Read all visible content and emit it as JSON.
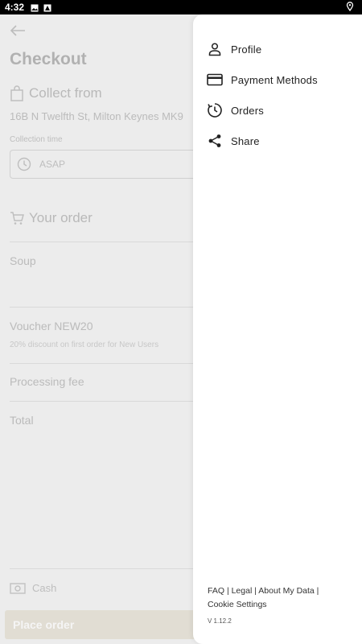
{
  "status_bar": {
    "time": "4:32"
  },
  "checkout": {
    "title": "Checkout",
    "collect_from": "Collect from",
    "address": "16B N  Twelfth St, Milton Keynes MK9",
    "collection_time_label": "Collection time",
    "collection_time_value": "ASAP",
    "your_order": "Your order",
    "items": [
      "Soup"
    ],
    "voucher": "Voucher NEW20",
    "voucher_desc": "20% discount on first order for New Users",
    "processing_fee": "Processing fee",
    "total": "Total",
    "payment_method": "Cash",
    "place_order": "Place order"
  },
  "drawer": {
    "menu": [
      {
        "label": "Profile",
        "icon": "person-icon"
      },
      {
        "label": "Payment Methods",
        "icon": "credit-card-icon"
      },
      {
        "label": "Orders",
        "icon": "history-icon"
      },
      {
        "label": "Share",
        "icon": "share-icon"
      }
    ],
    "footer": {
      "faq": "FAQ",
      "legal": "Legal",
      "about": "About My Data",
      "cookies": "Cookie Settings",
      "separator": "|"
    },
    "version": "V 1.12.2"
  }
}
